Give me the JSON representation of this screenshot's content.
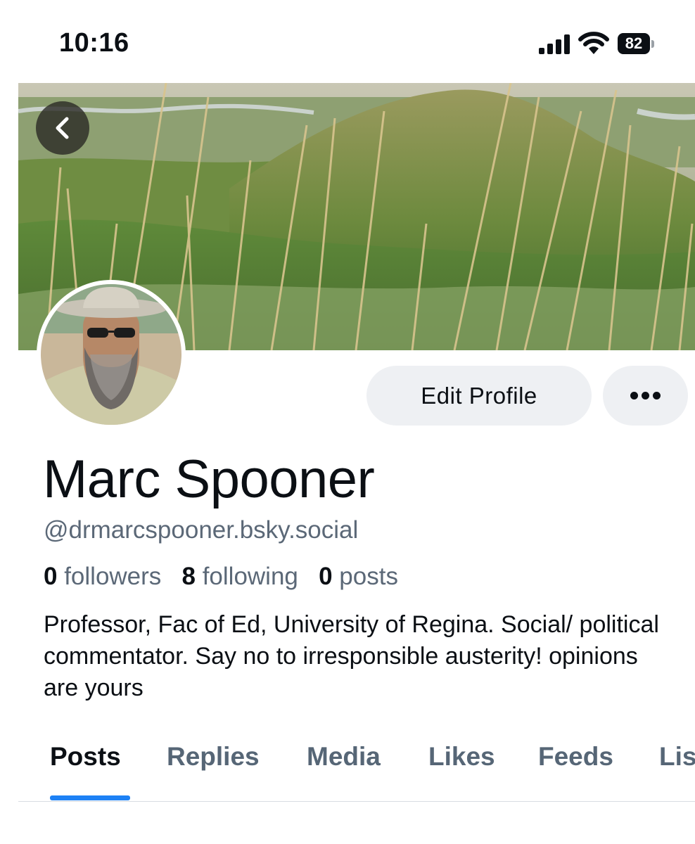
{
  "status_bar": {
    "time": "10:16",
    "battery": "82"
  },
  "profile": {
    "display_name": "Marc Spooner",
    "handle": "@drmarcspooner.bsky.social",
    "stats": {
      "followers_count": "0",
      "followers_label": "followers",
      "following_count": "8",
      "following_label": "following",
      "posts_count": "0",
      "posts_label": "posts"
    },
    "bio": "Professor, Fac of Ed, University of Regina. Social/ political commentator. Say no to irresponsible austerity! opinions are yours"
  },
  "actions": {
    "edit_profile": "Edit Profile"
  },
  "tabs": [
    {
      "label": "Posts",
      "active": true
    },
    {
      "label": "Replies"
    },
    {
      "label": "Media"
    },
    {
      "label": "Likes"
    },
    {
      "label": "Feeds"
    },
    {
      "label": "Lis"
    }
  ],
  "colors": {
    "accent": "#1d81f5",
    "button_bg": "#eef0f3",
    "muted_text": "#5b6877",
    "tab_inactive": "#566676"
  },
  "icons": {
    "back": "chevron-left-icon",
    "more": "ellipsis-icon",
    "signal": "cellular-signal-icon",
    "wifi": "wifi-icon",
    "battery": "battery-icon"
  }
}
